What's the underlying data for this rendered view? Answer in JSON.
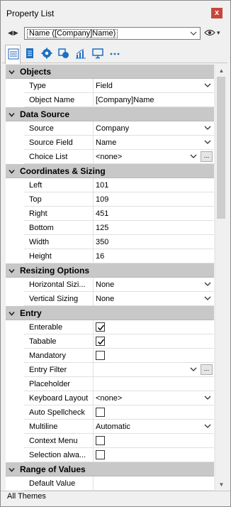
{
  "window": {
    "title": "Property List",
    "close_glyph": "x"
  },
  "selector": {
    "nav_glyph": "◀▶",
    "value": "Name ([Company]Name)",
    "eye_glyph": "👁",
    "caret_glyph": "▾"
  },
  "tabs": [
    {
      "icon": "list-icon",
      "active": true
    },
    {
      "icon": "document-icon",
      "active": false
    },
    {
      "icon": "gear-icon",
      "active": false
    },
    {
      "icon": "shapes-icon",
      "active": false
    },
    {
      "icon": "chart-icon",
      "active": false
    },
    {
      "icon": "monitor-icon",
      "active": false
    },
    {
      "icon": "more-icon",
      "active": false
    }
  ],
  "grid": {
    "sections": [
      {
        "title": "Objects",
        "rows": [
          {
            "name": "Type",
            "value": "Field",
            "dropdown": true
          },
          {
            "name": "Object Name",
            "value": "[Company]Name"
          }
        ]
      },
      {
        "title": "Data Source",
        "rows": [
          {
            "name": "Source",
            "value": "Company",
            "dropdown": true
          },
          {
            "name": "Source Field",
            "value": "Name",
            "dropdown": true
          },
          {
            "name": "Choice List",
            "value": "<none>",
            "dropdown": true,
            "button": "..."
          }
        ]
      },
      {
        "title": "Coordinates & Sizing",
        "rows": [
          {
            "name": "Left",
            "value": "101"
          },
          {
            "name": "Top",
            "value": "109"
          },
          {
            "name": "Right",
            "value": "451"
          },
          {
            "name": "Bottom",
            "value": "125"
          },
          {
            "name": "Width",
            "value": "350"
          },
          {
            "name": "Height",
            "value": "16"
          }
        ]
      },
      {
        "title": "Resizing Options",
        "rows": [
          {
            "name": "Horizontal Sizi...",
            "value": "None",
            "dropdown": true
          },
          {
            "name": "Vertical Sizing",
            "value": "None",
            "dropdown": true
          }
        ]
      },
      {
        "title": "Entry",
        "rows": [
          {
            "name": "Enterable",
            "checkbox": true,
            "checked": true
          },
          {
            "name": "Tabable",
            "checkbox": true,
            "checked": true
          },
          {
            "name": "Mandatory",
            "checkbox": true,
            "checked": false
          },
          {
            "name": "Entry Filter",
            "value": "",
            "dropdown": true,
            "button": "..."
          },
          {
            "name": "Placeholder",
            "value": ""
          },
          {
            "name": "Keyboard Layout",
            "value": "<none>",
            "dropdown": true
          },
          {
            "name": "Auto Spellcheck",
            "checkbox": true,
            "checked": false
          },
          {
            "name": "Multiline",
            "value": "Automatic",
            "dropdown": true
          },
          {
            "name": "Context Menu",
            "checkbox": true,
            "checked": false
          },
          {
            "name": "Selection alwa...",
            "checkbox": true,
            "checked": false
          }
        ]
      },
      {
        "title": "Range of Values",
        "rows": [
          {
            "name": "Default Value",
            "value": ""
          }
        ]
      }
    ]
  },
  "scrollbar": {
    "up_glyph": "▲",
    "down_glyph": "▼"
  },
  "status": {
    "text": "All Themes"
  },
  "colors": {
    "section_bg": "#c8c8c8",
    "close_bg": "#c8463b",
    "window_bg": "#f0f0f0"
  }
}
